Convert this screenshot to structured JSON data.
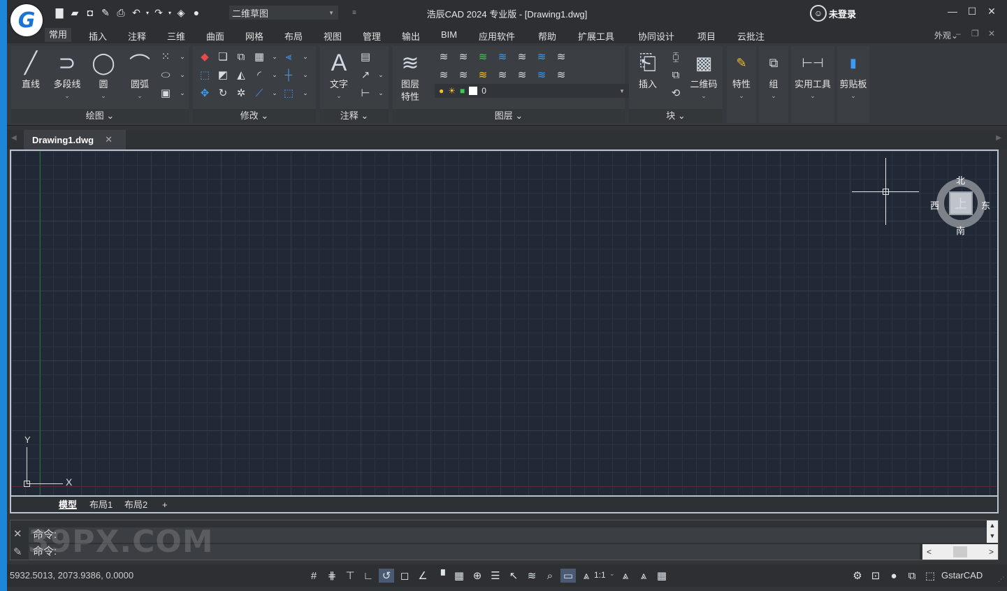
{
  "title": "浩辰CAD 2024 专业版 - [Drawing1.dwg]",
  "logo_letter": "G",
  "workspace": "二维草图",
  "login": "未登录",
  "quick_access": [
    "new-icon",
    "open-icon",
    "save-icon",
    "save-as-icon",
    "print-icon",
    "undo-icon",
    "redo-icon",
    "layer-stack-icon",
    "comment-icon"
  ],
  "menu_tabs": [
    "常用",
    "插入",
    "注释",
    "三维",
    "曲面",
    "网格",
    "布局",
    "视图",
    "管理",
    "输出",
    "BIM",
    "应用软件",
    "帮助",
    "扩展工具",
    "协同设计",
    "项目",
    "云批注"
  ],
  "appearance": "外观",
  "ribbon": {
    "draw": {
      "title": "绘图",
      "line": "直线",
      "polyline": "多段线",
      "circle": "圆",
      "arc": "圆弧"
    },
    "modify": {
      "title": "修改"
    },
    "annotation": {
      "title": "注释",
      "text": "文字"
    },
    "layers": {
      "title": "图层",
      "props_line1": "图层",
      "props_line2": "特性",
      "current_layer": "0"
    },
    "block": {
      "title": "块",
      "insert": "插入",
      "qrcode": "二维码"
    },
    "properties": "特性",
    "group": "组",
    "utilities": "实用工具",
    "clipboard": "剪贴板"
  },
  "doc_tab": "Drawing1.dwg",
  "compass": {
    "north": "北",
    "south": "南",
    "east": "东",
    "west": "西",
    "top": "上"
  },
  "ucs": {
    "x": "X",
    "y": "Y"
  },
  "layout_tabs": [
    "模型",
    "布局1",
    "布局2",
    "+"
  ],
  "command": {
    "history": "命令:",
    "prompt": "命令:"
  },
  "watermark": "39PX.COM",
  "coords": "5932.5013, 2073.9386, 0.0000",
  "scale": "1:1",
  "brand": "GstarCAD"
}
